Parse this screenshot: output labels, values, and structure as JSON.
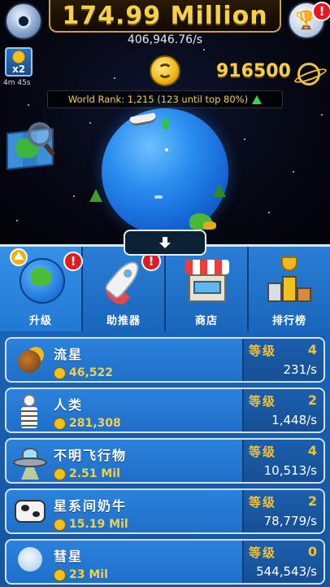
{
  "hud": {
    "money": "174.99 Million",
    "income_rate": "406,946.76/s",
    "gems": "916500",
    "boost_label": "x2",
    "boost_timer": "4m 45s",
    "world_rank": "World Rank: 1,215 (123 until top 80%)",
    "settings_icon": "gear-icon",
    "trophy_alert": "!"
  },
  "tabs": [
    {
      "label": "升级",
      "icon": "earth-icon",
      "alert": "!"
    },
    {
      "label": "助推器",
      "icon": "rocket-icon",
      "alert": "!"
    },
    {
      "label": "商店",
      "icon": "shop-icon",
      "alert": ""
    },
    {
      "label": "排行榜",
      "icon": "podium-icon",
      "alert": ""
    }
  ],
  "upgrades": [
    {
      "name": "流星",
      "cost": "46,522",
      "level_label": "等级",
      "level": "4",
      "rate": "231/s",
      "icon": "meteor-icon"
    },
    {
      "name": "人类",
      "cost": "281,308",
      "level_label": "等级",
      "level": "2",
      "rate": "1,448/s",
      "icon": "skeleton-icon"
    },
    {
      "name": "不明飞行物",
      "cost": "2.51 Mil",
      "level_label": "等级",
      "level": "4",
      "rate": "10,513/s",
      "icon": "ufo-icon"
    },
    {
      "name": "星系间奶牛",
      "cost": "15.19 Mil",
      "level_label": "等级",
      "level": "2",
      "rate": "78,779/s",
      "icon": "cow-icon"
    },
    {
      "name": "彗星",
      "cost": "23 Mil",
      "level_label": "等级",
      "level": "0",
      "rate": "544,543/s",
      "icon": "comet-icon"
    }
  ],
  "colors": {
    "gold": "#f5d04a",
    "panel_blue": "#1f6fc8",
    "alert_red": "#e21a22"
  }
}
